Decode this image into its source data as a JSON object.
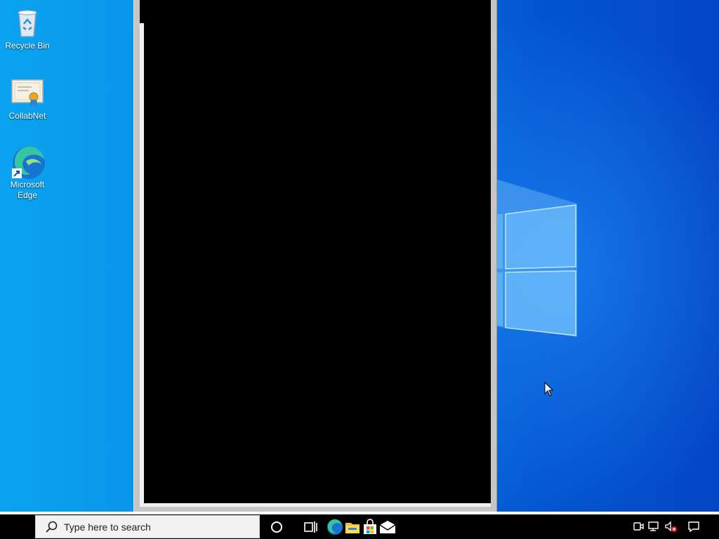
{
  "desktop": {
    "icons": [
      {
        "label": "Recycle Bin",
        "icon": "recycle-bin-icon"
      },
      {
        "label": "CollabNet",
        "icon": "certificate-icon"
      },
      {
        "label": "Microsoft Edge",
        "icon": "edge-icon"
      }
    ]
  },
  "taskbar": {
    "search_placeholder": "Type here to search",
    "pinned": [
      "cortana-icon",
      "task-view-icon",
      "edge-icon",
      "file-explorer-icon",
      "store-icon",
      "mail-icon"
    ],
    "tray": [
      "meet-now-icon",
      "network-icon",
      "volume-muted-icon",
      "notification-icon"
    ]
  },
  "colors": {
    "desktop_blue": "#0a72e0",
    "window_content": "#000000",
    "taskbar": "#000000"
  }
}
